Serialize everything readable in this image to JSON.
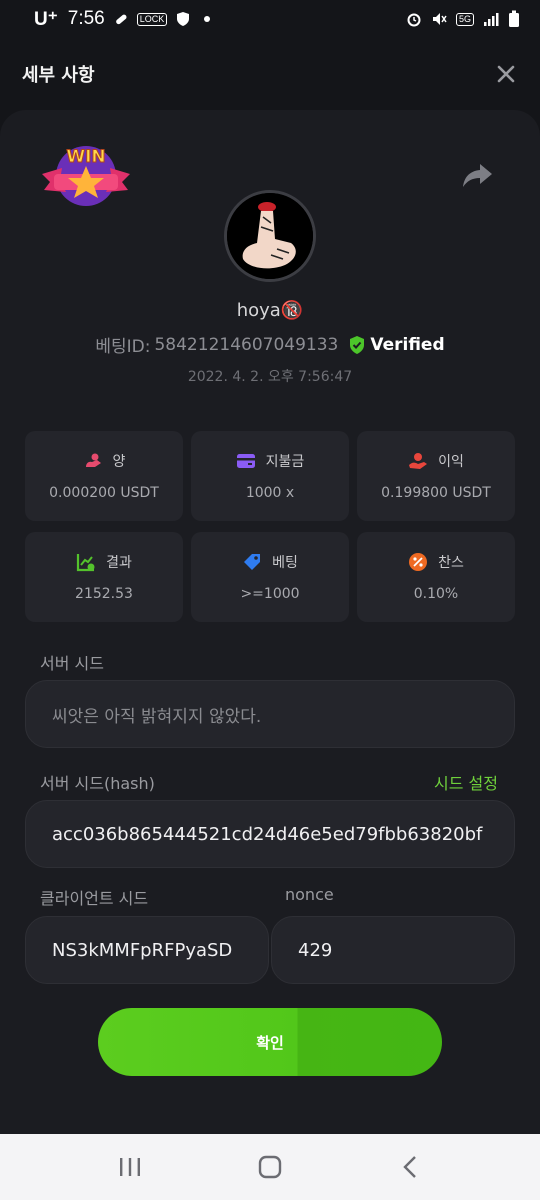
{
  "status_bar": {
    "carrier": "U⁺",
    "time": "7:56",
    "lock_badge": "LOCK",
    "net": "5G"
  },
  "header": {
    "title": "세부 사항"
  },
  "profile": {
    "username": "hoya🔞",
    "bet_id_label": "베팅ID:",
    "bet_id": "58421214607049133",
    "verified": "Verified",
    "timestamp": "2022. 4. 2. 오후 7:56:47"
  },
  "stats": [
    {
      "label": "양",
      "value": "0.000200 USDT",
      "icon": "coins-icon",
      "color": "#e64b6e"
    },
    {
      "label": "지불금",
      "value": "1000 x",
      "icon": "card-icon",
      "color": "#8a5cf5"
    },
    {
      "label": "이익",
      "value": "0.199800 USDT",
      "icon": "profit-icon",
      "color": "#e8463c"
    },
    {
      "label": "결과",
      "value": "2152.53",
      "icon": "chart-check-icon",
      "color": "#54c22c"
    },
    {
      "label": "베팅",
      "value": ">=1000",
      "icon": "tag-icon",
      "color": "#2f7cf0"
    },
    {
      "label": "찬스",
      "value": "0.10%",
      "icon": "percent-icon",
      "color": "#ef6a22"
    }
  ],
  "server_seed": {
    "label": "서버 시드",
    "value": "씨앗은 아직 밝혀지지 않았다."
  },
  "server_seed_hash": {
    "label": "서버 시드(hash)",
    "action": "시드 설정",
    "value": "acc036b865444521cd24d46e5ed79fbb63820bf"
  },
  "client_seed": {
    "label": "클라이언트 시드",
    "value": "NS3kMMFpRFPyaSD"
  },
  "nonce": {
    "label": "nonce",
    "value": "429"
  },
  "confirm_button": {
    "label": "확인"
  },
  "colors": {
    "accent": "#5ccd1f",
    "panel": "#1b1c21",
    "background": "#141519"
  }
}
